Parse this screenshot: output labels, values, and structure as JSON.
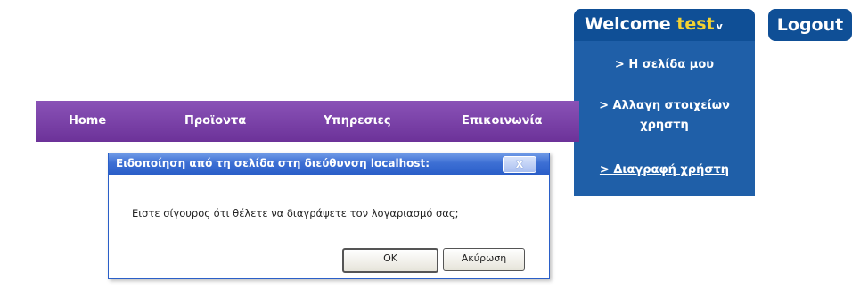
{
  "nav": {
    "items": [
      {
        "label": "Home"
      },
      {
        "label": "Προϊοντα"
      },
      {
        "label": "Υπηρεσιες"
      },
      {
        "label": "Επικοινωνία"
      }
    ]
  },
  "user_menu": {
    "welcome_prefix": "Welcome ",
    "username": "test",
    "caret": "v",
    "items": [
      {
        "label": "> Η σελίδα μου"
      },
      {
        "label": "> Αλλαγη στοιχείων"
      },
      {
        "label": "χρηστη"
      },
      {
        "label": "> Διαγραφή χρήστη"
      }
    ]
  },
  "logout_label": "Logout",
  "dialog": {
    "title": "Ειδοποίηση από τη σελίδα στη διεύθυνση localhost:",
    "close_label": "X",
    "message": "Ειστε σίγουρος ότι θέλετε να διαγράψετε τον λογαριασμό σας;",
    "ok_label": "OK",
    "cancel_label": "Ακύρωση"
  }
}
